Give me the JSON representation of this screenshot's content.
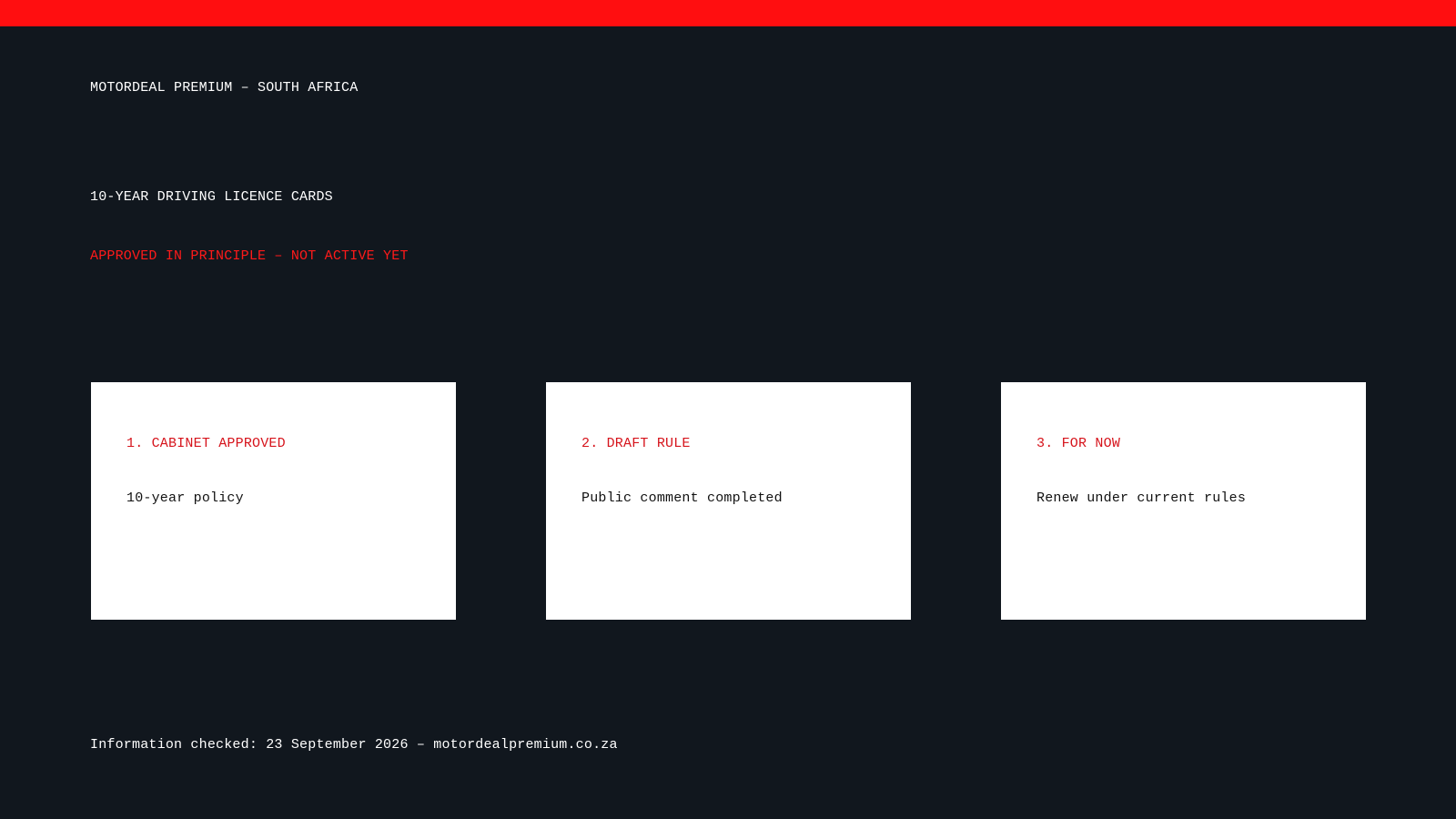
{
  "colors": {
    "background": "#11171e",
    "accent": "#ff0e10",
    "card_background": "#ffffff",
    "card_title": "#d6141c",
    "status_text": "#ff1a1a"
  },
  "header": {
    "brand": "MOTORDEAL PREMIUM – SOUTH AFRICA"
  },
  "main": {
    "headline": "10-YEAR DRIVING LICENCE CARDS",
    "status": "APPROVED IN PRINCIPLE – NOT ACTIVE YET",
    "cards": [
      {
        "title": "1. CABINET APPROVED",
        "body": "10-year policy"
      },
      {
        "title": "2. DRAFT RULE",
        "body": "Public comment completed"
      },
      {
        "title": "3. FOR NOW",
        "body": "Renew under current rules"
      }
    ]
  },
  "footer": {
    "text": "Information checked: 23 September 2026 – motordealpremium.co.za"
  }
}
